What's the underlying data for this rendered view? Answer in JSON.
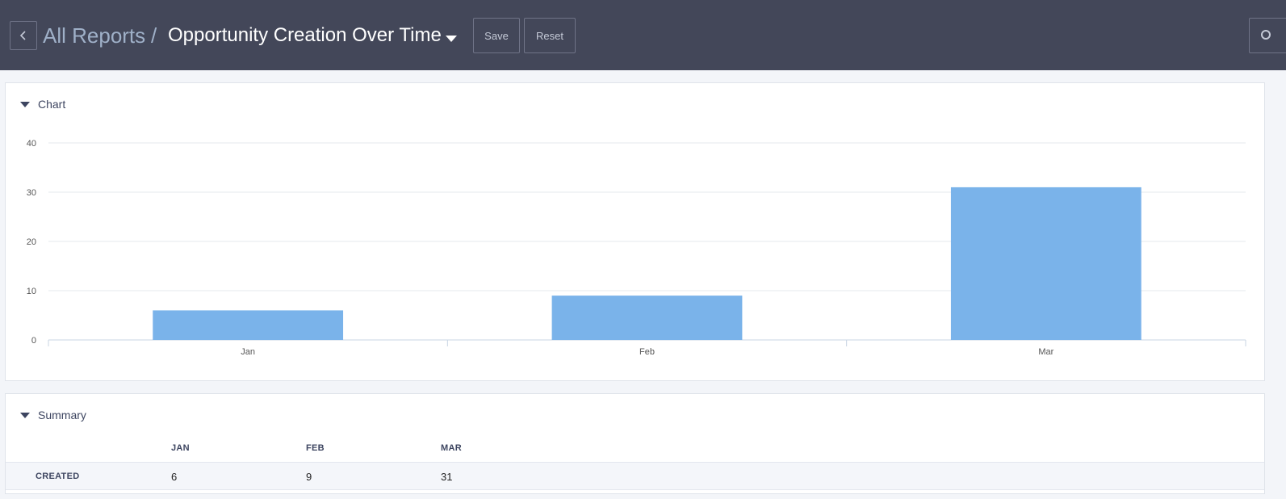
{
  "header": {
    "breadcrumb_all": "All Reports",
    "breadcrumb_sep": "/",
    "title": "Opportunity Creation Over Time",
    "save_label": "Save",
    "reset_label": "Reset",
    "bg_color": "#434759"
  },
  "chart_panel": {
    "title": "Chart"
  },
  "chart_data": {
    "type": "bar",
    "categories": [
      "Jan",
      "Feb",
      "Mar"
    ],
    "values": [
      6,
      9,
      31
    ],
    "ylim": [
      0,
      40
    ],
    "yticks": [
      0,
      10,
      20,
      30,
      40
    ],
    "grid": true,
    "bar_color": "#7ab3ea"
  },
  "summary_panel": {
    "title": "Summary",
    "columns": [
      "JAN",
      "FEB",
      "MAR"
    ],
    "row_label": "CREATED",
    "row_values": [
      "6",
      "9",
      "31"
    ]
  }
}
